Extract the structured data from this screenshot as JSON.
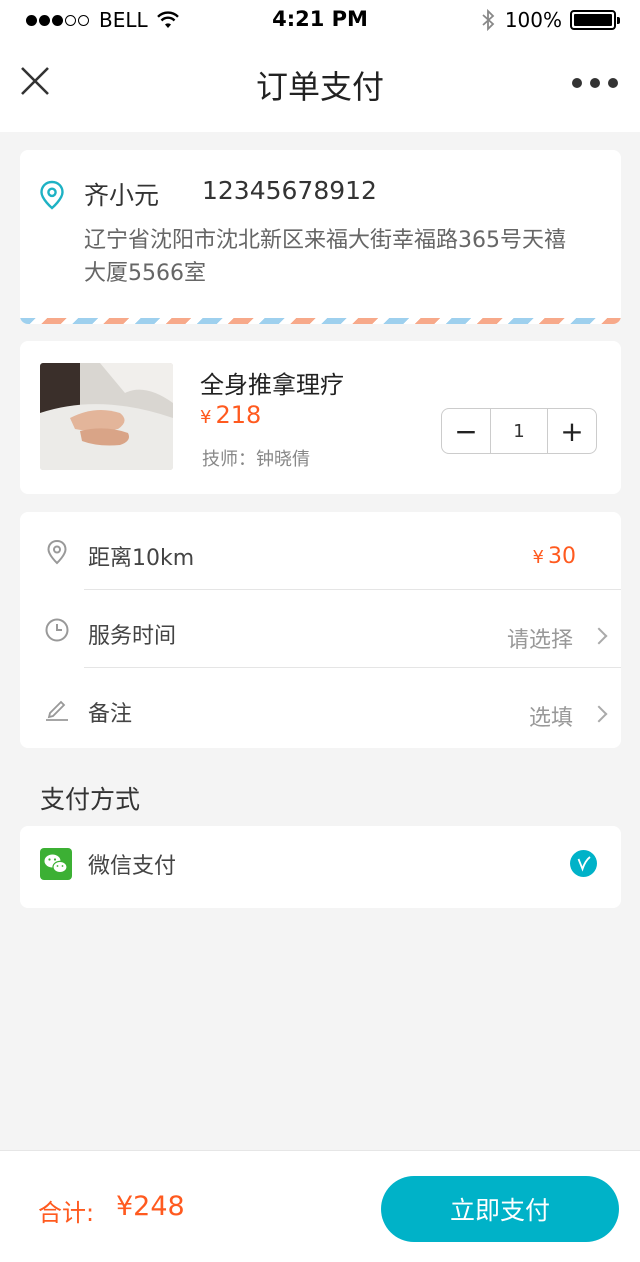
{
  "status_bar": {
    "carrier": "BELL",
    "time": "4:21 PM",
    "battery": "100%"
  },
  "nav": {
    "title": "订单支付"
  },
  "address": {
    "name": "齐小元",
    "phone": "12345678912",
    "text": "辽宁省沈阳市沈北新区来福大街幸福路365号天禧大厦5566室"
  },
  "item": {
    "name": "全身推拿理疗",
    "currency": "¥",
    "price": "218",
    "technician": "技师：钟晓倩",
    "quantity": "1",
    "minus": "−",
    "plus": "+"
  },
  "details": {
    "distance_label": "距离10km",
    "distance_currency": "¥",
    "distance_fee": "30",
    "time_label": "服务时间",
    "time_value": "请选择",
    "note_label": "备注",
    "note_value": "选填"
  },
  "payment": {
    "header": "支付方式",
    "method": "微信支付"
  },
  "footer": {
    "total_label": "合计:",
    "total_value": "¥248",
    "pay_button": "立即支付"
  },
  "colors": {
    "accent": "#00b2c8",
    "price": "#ff5a1f",
    "wechat": "#3cb034"
  }
}
